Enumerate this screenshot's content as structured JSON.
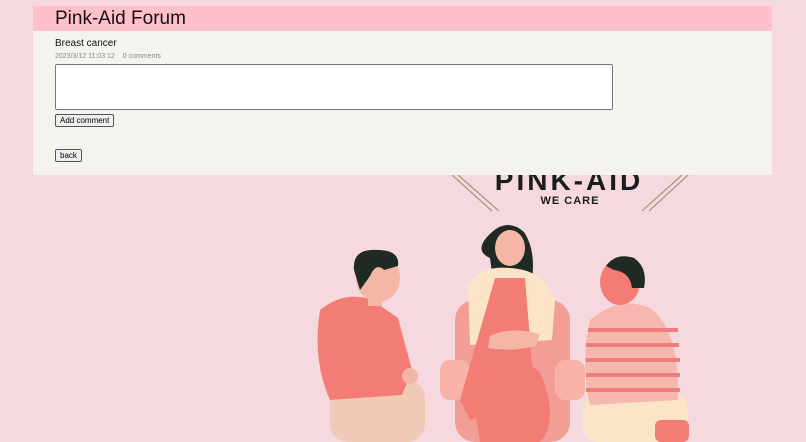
{
  "app": {
    "title": "Pink-Aid Forum"
  },
  "post": {
    "title": "Breast cancer",
    "timestamp": "2023/3/12 11:03:12",
    "comments": "0 comments"
  },
  "comment_box": {
    "value": "",
    "placeholder": ""
  },
  "buttons": {
    "add_comment": "Add comment",
    "back": "back"
  },
  "background": {
    "brand": "PINK-AID",
    "tagline": "WE CARE"
  },
  "colors": {
    "page_bg": "#f5d9df",
    "header_bg": "#ffc0cb",
    "panel_bg": "#f4f3ee"
  }
}
